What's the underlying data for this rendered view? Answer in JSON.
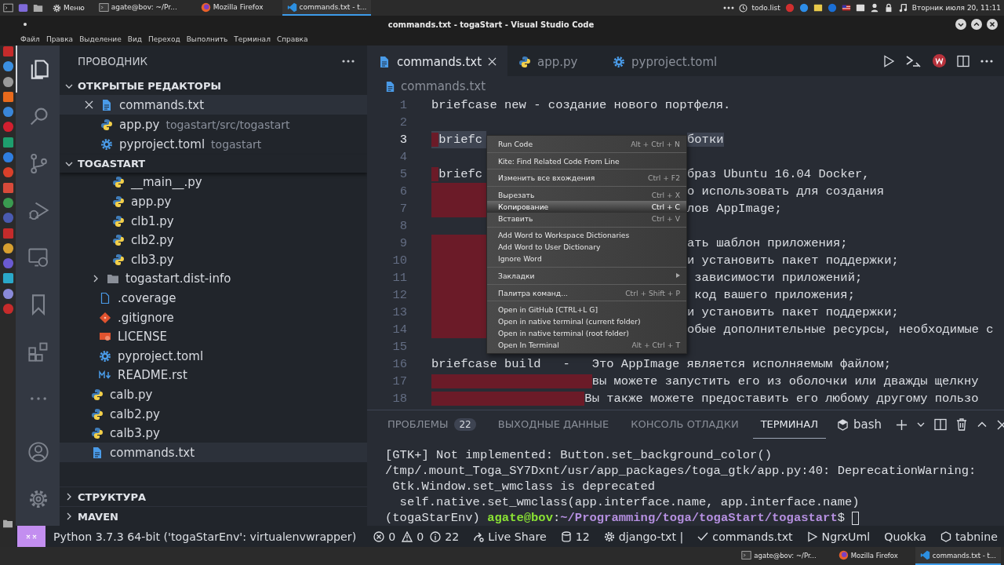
{
  "top_panel": {
    "menu_label": "Меню",
    "tasks": [
      {
        "label": "agate@bov: ~/Pr...",
        "kind": "terminal",
        "selected": false
      },
      {
        "label": "Mozilla Firefox",
        "kind": "firefox",
        "selected": false
      },
      {
        "label": "commands.txt - t...",
        "kind": "vscode",
        "selected": true
      }
    ],
    "todo_label": "todo.list",
    "clock": "Вторник июля 20, 11:11"
  },
  "window": {
    "title": "commands.txt - togaStart - Visual Studio Code"
  },
  "menu_bar": [
    "Файл",
    "Правка",
    "Выделение",
    "Вид",
    "Переход",
    "Выполнить",
    "Терминал",
    "Справка"
  ],
  "activity_bar": [
    {
      "kind": "files",
      "selected": true
    },
    {
      "kind": "search",
      "selected": false
    },
    {
      "kind": "source-control",
      "selected": false
    },
    {
      "kind": "debug",
      "selected": false
    },
    {
      "kind": "remote",
      "selected": false
    },
    {
      "kind": "bookmark",
      "selected": false
    },
    {
      "kind": "extensions",
      "selected": false
    },
    {
      "kind": "more",
      "selected": false
    },
    {
      "kind": "account",
      "selected": false
    },
    {
      "kind": "settings",
      "selected": false
    }
  ],
  "sidebar": {
    "title": "ПРОВОДНИК",
    "open_editors": {
      "title": "ОТКРЫТЫЕ РЕДАКТОРЫ",
      "expanded": true,
      "items": [
        {
          "label": "commands.txt",
          "kind": "text",
          "selected": true
        },
        {
          "label": "app.py",
          "description": "togastart/src/togastart",
          "kind": "python",
          "selected": false
        },
        {
          "label": "pyproject.toml",
          "description": "togastart",
          "kind": "gear",
          "selected": false
        }
      ]
    },
    "folder": {
      "title": "TOGASTART",
      "expanded": true,
      "tree": [
        {
          "children": [
            {
              "children": [
                {
                  "label": "__main__.py",
                  "kind": "python",
                  "selected": false
                },
                {
                  "label": "app.py",
                  "kind": "python",
                  "selected": false
                },
                {
                  "label": "clb1.py",
                  "kind": "python",
                  "selected": false
                },
                {
                  "label": "clb2.py",
                  "kind": "python",
                  "selected": false
                },
                {
                  "label": "clb3.py",
                  "kind": "python",
                  "selected": false
                }
              ]
            },
            {
              "label": "togastart.dist-info",
              "kind": "folder",
              "expanded": false,
              "selected": false
            },
            {
              "label": ".coverage",
              "kind": "file",
              "selected": false
            },
            {
              "label": ".gitignore",
              "kind": "git",
              "selected": false
            },
            {
              "label": "LICENSE",
              "kind": "license",
              "selected": false
            },
            {
              "label": "pyproject.toml",
              "kind": "gear",
              "selected": false
            },
            {
              "label": "README.rst",
              "kind": "markdown",
              "selected": false
            }
          ]
        },
        {
          "label": "calb.py",
          "kind": "python",
          "selected": false
        },
        {
          "label": "calb2.py",
          "kind": "python",
          "selected": false
        },
        {
          "label": "calb3.py",
          "kind": "python",
          "selected": false
        },
        {
          "label": "commands.txt",
          "kind": "text",
          "selected": true
        }
      ]
    },
    "sections": [
      {
        "title": "СТРУКТУРА",
        "expanded": false
      },
      {
        "title": "MAVEN",
        "expanded": false
      }
    ]
  },
  "editor": {
    "tabs": [
      {
        "label": "commands.txt",
        "kind": "text",
        "selected": true
      },
      {
        "label": "app.py",
        "kind": "python",
        "selected": false
      },
      {
        "label": "pyproject.toml",
        "kind": "gear",
        "selected": false
      }
    ],
    "breadcrumb": "commands.txt",
    "lines": [
      {
        "number": "1",
        "kind": "full",
        "text": "briefcase new - создание нового портфеля.",
        "current": false,
        "whitespace_marked": false,
        "selected": false
      },
      {
        "number": "2",
        "kind": "full",
        "current": false,
        "whitespace_marked": false,
        "selected": false
      },
      {
        "number": "3",
        "kind": "split",
        "left": " briefc",
        "right": "ботки",
        "current": true,
        "whitespace_marked": true,
        "selected": true
      },
      {
        "number": "4",
        "kind": "split",
        "current": false,
        "whitespace_marked": false,
        "selected": false
      },
      {
        "number": "5",
        "kind": "split",
        "left": " briefc",
        "right": "браз Ubuntu 16.04 Docker,",
        "current": false,
        "whitespace_marked": true,
        "selected": false
      },
      {
        "number": "6",
        "kind": "split",
        "right": "о использовать для создания",
        "current": false,
        "whitespace_marked": true,
        "selected": false
      },
      {
        "number": "7",
        "kind": "split",
        "right": "лов AppImage;",
        "current": false,
        "whitespace_marked": true,
        "selected": false
      },
      {
        "number": "8",
        "kind": "split",
        "current": false,
        "whitespace_marked": false,
        "selected": false
      },
      {
        "number": "9",
        "kind": "split",
        "right": "ать шаблон приложения;",
        "current": false,
        "whitespace_marked": true,
        "selected": false
      },
      {
        "number": "10",
        "kind": "split",
        "right": "и установить пакет поддержки;",
        "current": false,
        "whitespace_marked": true,
        "selected": false
      },
      {
        "number": "11",
        "kind": "split",
        "right": " зависимости приложений;",
        "current": false,
        "whitespace_marked": true,
        "selected": false
      },
      {
        "number": "12",
        "kind": "split",
        "right": " код вашего приложения;",
        "current": false,
        "whitespace_marked": true,
        "selected": false
      },
      {
        "number": "13",
        "kind": "split",
        "right": "и установить пакет поддержки;",
        "current": false,
        "whitespace_marked": true,
        "selected": false
      },
      {
        "number": "14",
        "kind": "split",
        "right": "обые дополнительные ресурсы, необходимые с",
        "current": false,
        "whitespace_marked": true,
        "selected": false
      },
      {
        "number": "15",
        "kind": "full",
        "current": false,
        "whitespace_marked": false,
        "selected": false
      },
      {
        "number": "16",
        "kind": "full",
        "text": "briefcase build   -   Это AppImage является исполняемым файлом;",
        "current": false,
        "whitespace_marked": false,
        "selected": false
      },
      {
        "number": "17",
        "kind": "full",
        "text": "                      вы можете запустить его из оболочки или дважды щелкну",
        "current": false,
        "whitespace_marked": true,
        "selected": false
      },
      {
        "number": "18",
        "kind": "full",
        "text": "                     Вы также можете предоставить его любому другому пользо",
        "current": false,
        "whitespace_marked": true,
        "selected": false
      }
    ]
  },
  "context_menu": {
    "items": [
      {
        "kind": "item",
        "label": "Run Code",
        "shortcut": "Alt + Ctrl + N",
        "selected": false
      },
      {
        "kind": "separator"
      },
      {
        "kind": "item",
        "label": "Kite: Find Related Code From Line",
        "selected": false
      },
      {
        "kind": "separator"
      },
      {
        "kind": "item",
        "label": "Изменить все вхождения",
        "shortcut": "Ctrl + F2",
        "selected": false
      },
      {
        "kind": "separator"
      },
      {
        "kind": "item",
        "label": "Вырезать",
        "shortcut": "Ctrl + X",
        "selected": false
      },
      {
        "kind": "item",
        "label": "Копирование",
        "shortcut": "Ctrl + C",
        "selected": true
      },
      {
        "kind": "item",
        "label": "Вставить",
        "shortcut": "Ctrl + V",
        "selected": false
      },
      {
        "kind": "separator"
      },
      {
        "kind": "item",
        "label": "Add Word to Workspace Dictionaries",
        "selected": false
      },
      {
        "kind": "item",
        "label": "Add Word to User Dictionary",
        "selected": false
      },
      {
        "kind": "item",
        "label": "Ignore Word",
        "selected": false
      },
      {
        "kind": "separator"
      },
      {
        "kind": "item",
        "label": "Закладки",
        "submenu": true,
        "selected": false
      },
      {
        "kind": "separator"
      },
      {
        "kind": "item",
        "label": "Палитра команд...",
        "shortcut": "Ctrl + Shift + P",
        "selected": false
      },
      {
        "kind": "separator"
      },
      {
        "kind": "item",
        "label": "Open in GitHub [CTRL+L G]",
        "selected": false
      },
      {
        "kind": "item",
        "label": "Open in native terminal (current folder)",
        "selected": false
      },
      {
        "kind": "item",
        "label": "Open in native terminal (root folder)",
        "selected": false
      },
      {
        "kind": "item",
        "label": "Open In Terminal",
        "shortcut": "Alt + Ctrl + T",
        "selected": false
      }
    ]
  },
  "panel": {
    "tabs": [
      {
        "label": "ПРОБЛЕМЫ",
        "badge": "22",
        "selected": false
      },
      {
        "label": "ВЫХОДНЫЕ ДАННЫЕ",
        "selected": false
      },
      {
        "label": "КОНСОЛЬ ОТЛАДКИ",
        "selected": false
      },
      {
        "label": "ТЕРМИНАЛ",
        "selected": true
      }
    ],
    "shell": "bash",
    "lines": [
      {
        "segments": [
          {
            "text": "[GTK+] Not implemented: Button.set_background_color()",
            "color": "#dcdfe4"
          }
        ]
      },
      {
        "segments": [
          {
            "text": "/tmp/.mount_Toga_SY7Dxnt/usr/app_packages/toga_gtk/app.py:40: DeprecationWarning:",
            "color": "#dcdfe4"
          }
        ]
      },
      {
        "segments": [
          {
            "text": " Gtk.Window.set_wmclass is deprecated",
            "color": "#dcdfe4"
          }
        ]
      },
      {
        "segments": [
          {
            "text": "  self.native.set_wmclass(app.interface.name, app.interface.name)",
            "color": "#dcdfe4"
          }
        ]
      },
      {
        "segments": [
          {
            "text": "(togaStarEnv) ",
            "color": "#dcdfe4"
          },
          {
            "text": "agate@bov",
            "color": "#8ae234"
          },
          {
            "text": ":",
            "color": "#dcdfe4"
          },
          {
            "text": "~/Programming/toga/togaStart/togastart",
            "color": "#b58fe0"
          },
          {
            "text": "$ ",
            "color": "#dcdfe4"
          }
        ],
        "cursor": true
      }
    ]
  },
  "status_bar": {
    "interpreter": "Python 3.7.3 64-bit ('togaStarEnv': virtualenvwrapper)",
    "items": [
      {
        "kind": "error",
        "text": "0"
      },
      {
        "kind": "warning",
        "text": "0"
      },
      {
        "kind": "info",
        "text": "22"
      },
      {
        "kind": "share",
        "text": "Live Share"
      },
      {
        "kind": "database",
        "text": "12"
      },
      {
        "kind": "gear",
        "text": "django-txt |"
      },
      {
        "kind": "check",
        "text": "commands.txt"
      },
      {
        "kind": "play",
        "text": "NgrxUml"
      },
      {
        "text": "Quokka"
      },
      {
        "kind": "hexagon",
        "text": "tabnine"
      }
    ]
  },
  "taskbar": [
    {
      "label": "agate@bov: ~/Pr...",
      "kind": "terminal",
      "selected": false
    },
    {
      "label": "Mozilla Firefox",
      "kind": "firefox",
      "selected": false
    },
    {
      "label": "commands.txt - t...",
      "kind": "vscode",
      "selected": true
    }
  ]
}
